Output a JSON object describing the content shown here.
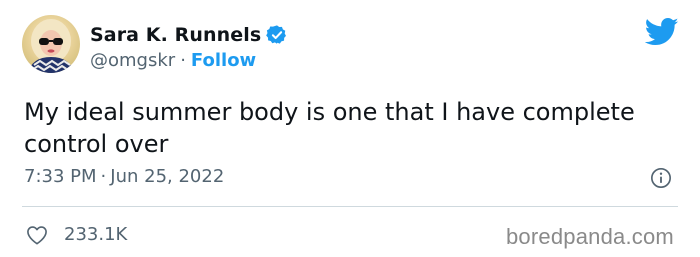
{
  "author": {
    "display_name": "Sara K. Runnels",
    "handle": "@omgskr",
    "separator": "·",
    "follow_label": "Follow",
    "verified": true
  },
  "tweet": {
    "text": "My ideal summer body is one that I have complete control over",
    "time": "7:33 PM",
    "date": "Jun 25, 2022",
    "meta_separator": "·"
  },
  "engagement": {
    "likes": "233.1K"
  },
  "watermark": "boredpanda.com",
  "icons": {
    "brand": "twitter-bird-icon",
    "verified": "verified-badge-icon",
    "info": "info-icon",
    "like": "heart-icon"
  },
  "colors": {
    "accent": "#1d9bf0",
    "text": "#0f1419",
    "secondary": "#536471",
    "divider": "#cfd9de"
  }
}
